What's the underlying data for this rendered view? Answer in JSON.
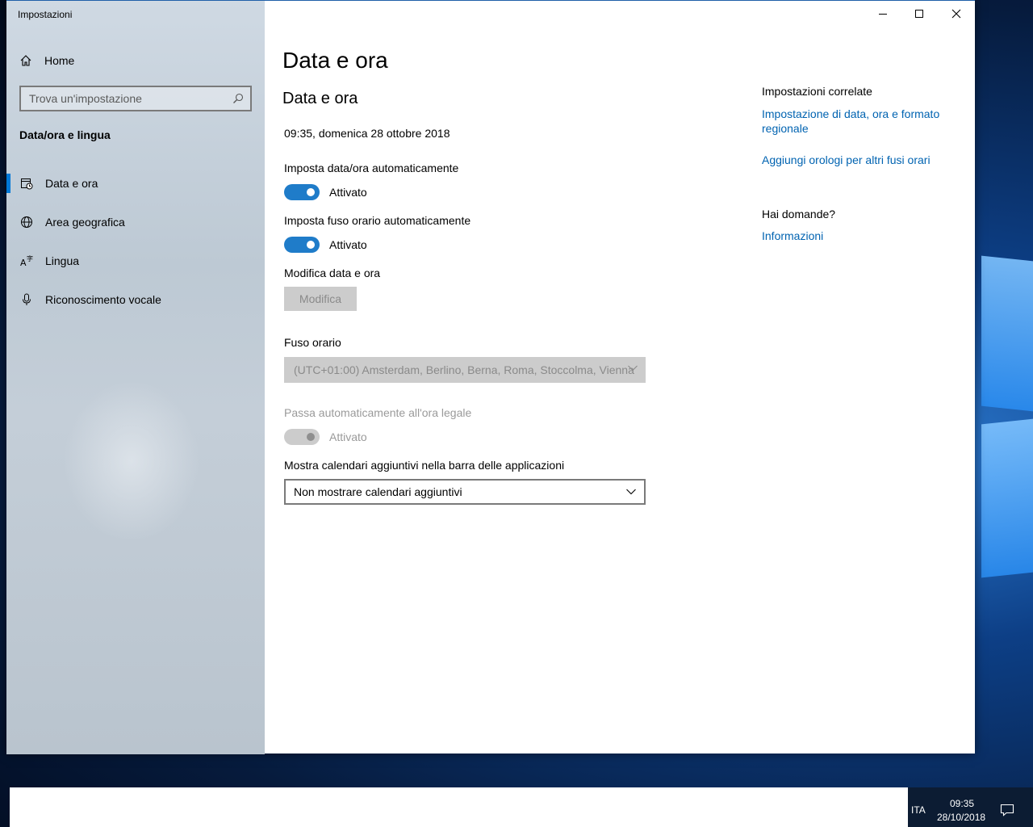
{
  "window": {
    "app_title": "Impostazioni"
  },
  "sidebar": {
    "home_label": "Home",
    "search_placeholder": "Trova un'impostazione",
    "section_title": "Data/ora e lingua",
    "items": [
      {
        "label": "Data e ora",
        "icon": "calendar-clock-icon",
        "active": true
      },
      {
        "label": "Area geografica",
        "icon": "globe-icon",
        "active": false
      },
      {
        "label": "Lingua",
        "icon": "language-icon",
        "active": false
      },
      {
        "label": "Riconoscimento vocale",
        "icon": "microphone-icon",
        "active": false
      }
    ]
  },
  "main": {
    "page_title": "Data e ora",
    "sub_title": "Data e ora",
    "current_datetime": "09:35, domenica 28 ottobre 2018",
    "auto_time": {
      "label": "Imposta data/ora automaticamente",
      "state": "Attivato",
      "on": true
    },
    "auto_timezone": {
      "label": "Imposta fuso orario automaticamente",
      "state": "Attivato",
      "on": true
    },
    "change_datetime": {
      "label": "Modifica data e ora",
      "button": "Modifica"
    },
    "timezone": {
      "label": "Fuso orario",
      "value": "(UTC+01:00) Amsterdam, Berlino, Berna, Roma, Stoccolma, Vienna"
    },
    "dst": {
      "label": "Passa automaticamente all'ora legale",
      "state": "Attivato",
      "disabled": true
    },
    "calendars": {
      "label": "Mostra calendari aggiuntivi nella barra delle applicazioni",
      "value": "Non mostrare calendari aggiuntivi"
    }
  },
  "related": {
    "title": "Impostazioni correlate",
    "links": [
      "Impostazione di data, ora e formato regionale",
      "Aggiungi orologi per altri fusi orari"
    ],
    "questions_title": "Hai domande?",
    "info_link": "Informazioni"
  },
  "taskbar": {
    "language": "ITA",
    "time": "09:35",
    "date": "28/10/2018"
  },
  "colors": {
    "accent": "#0078d7",
    "link": "#0063b1",
    "toggle_on": "#1f7cc9"
  }
}
